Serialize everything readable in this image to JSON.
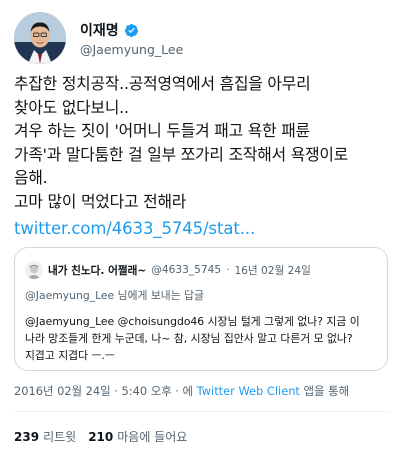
{
  "author": {
    "display_name": "이재명",
    "handle": "@Jaemyung_Lee",
    "verified": true,
    "verified_color": "#1d9bf0"
  },
  "tweet": {
    "lines": [
      "추잡한 정치공작..공적영역에서 흠집을 아무리",
      "찾아도 없다보니..",
      "겨우 하는 짓이 '어머니 두들겨 패고 욕한 패륜",
      "가족'과 말다툼한 걸 일부 쪼가리 조작해서 욕쟁이로",
      "음해.",
      "고마 많이 먹었다고 전해라"
    ],
    "link": "twitter.com/4633_5745/stat..."
  },
  "quoted_tweet": {
    "display_name": "내가 친노다. 어쩔래~",
    "handle": "@4633_5745",
    "date": "16년 02월 24일",
    "separator": "·",
    "reply_to_mention": "@Jaemyung_Lee",
    "reply_to_suffix": " 님에게 보내는 답글",
    "lines": [
      "@Jaemyung_Lee @choisungdo46 시장님 털게 그렇게 없나? 지금 이",
      "나라 망조들게 한게 누군데, 나~ 참, 시장님 집안사 말고 다른거 모 없나?",
      "지겹고 지겹다 ㅡ.ㅡ"
    ]
  },
  "timestamp": {
    "datetime": "2016년 02월 24일 · 5:40 오후 · 에",
    "client": "Twitter Web Client",
    "suffix": "앱을 통해"
  },
  "stats": {
    "retweets_count": "239",
    "retweets_label": "리트윗",
    "likes_count": "210",
    "likes_label": "마음에 들어요"
  },
  "colors": {
    "accent": "#1d9bf0",
    "text_primary": "#0f1419",
    "text_secondary": "#536471",
    "border": "#cfd9de"
  }
}
